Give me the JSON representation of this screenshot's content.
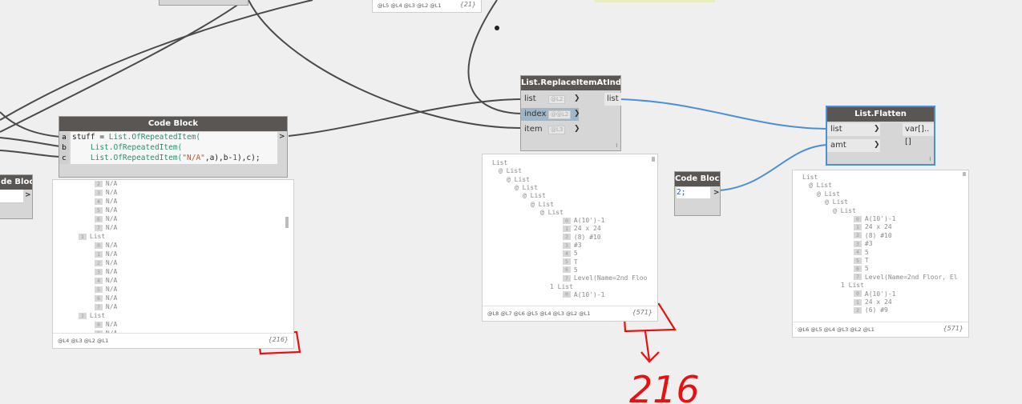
{
  "colors": {
    "canvas": "#efefef",
    "title_bar": "#5a5654",
    "node_body": "#d6d6d6",
    "wire": "#4a4a4a",
    "wire_active": "#4a90d9",
    "annotation": "#e81010"
  },
  "code_block_main": {
    "title": "Code Block",
    "ports": [
      "a",
      "b",
      "c"
    ],
    "line1_prefix": "stuff = ",
    "line1_fn": "List.OfRepeatedItem(",
    "line2_fn": "List.OfRepeatedItem(",
    "line3_fn": "List.OfRepeatedItem(",
    "line3_str": "\"N/A\"",
    "line3_rest": ",a),b-",
    "line3_num": "1",
    "line3_end": "),c);",
    "output_arrow": ">"
  },
  "code_block_left": {
    "title": "de Block",
    "output_arrow": ">"
  },
  "code_block_small": {
    "title": "Code Block",
    "code_value": "2;",
    "output_arrow": ">"
  },
  "replace_node": {
    "title": "List.ReplaceItemAtIndex",
    "inputs": [
      {
        "label": "list",
        "lacing": "@L2"
      },
      {
        "label": "index",
        "lacing": "@@L2"
      },
      {
        "label": "item",
        "lacing": "@L3"
      }
    ],
    "output": "list",
    "corner": "l"
  },
  "flatten_node": {
    "title": "List.Flatten",
    "inputs": [
      {
        "label": "list"
      },
      {
        "label": "amt"
      }
    ],
    "output": "var[]..[]",
    "corner": "l"
  },
  "preview_main": {
    "rows": [
      {
        "indent": 0,
        "idx": "2",
        "text": "N/A"
      },
      {
        "indent": 0,
        "idx": "3",
        "text": "N/A"
      },
      {
        "indent": 0,
        "idx": "4",
        "text": "N/A"
      },
      {
        "indent": 0,
        "idx": "5",
        "text": "N/A"
      },
      {
        "indent": 0,
        "idx": "6",
        "text": "N/A"
      },
      {
        "indent": 0,
        "idx": "7",
        "text": "N/A"
      },
      {
        "indent": -1,
        "idx": "1",
        "text": "List"
      },
      {
        "indent": 0,
        "idx": "0",
        "text": "N/A"
      },
      {
        "indent": 0,
        "idx": "1",
        "text": "N/A"
      },
      {
        "indent": 0,
        "idx": "2",
        "text": "N/A"
      },
      {
        "indent": 0,
        "idx": "3",
        "text": "N/A"
      },
      {
        "indent": 0,
        "idx": "4",
        "text": "N/A"
      },
      {
        "indent": 0,
        "idx": "5",
        "text": "N/A"
      },
      {
        "indent": 0,
        "idx": "6",
        "text": "N/A"
      },
      {
        "indent": 0,
        "idx": "7",
        "text": "N/A"
      },
      {
        "indent": -1,
        "idx": "2",
        "text": "List"
      },
      {
        "indent": 0,
        "idx": "0",
        "text": "N/A"
      },
      {
        "indent": 0,
        "idx": "1",
        "text": "N/A"
      }
    ],
    "levels": "@L4 @L3 @L2 @L1",
    "count": "{216}"
  },
  "preview_replace": {
    "rows": [
      "List",
      "@ List",
      "@ List",
      "@ List",
      "@ List",
      "@ List",
      "@ List",
      "A(10')-1",
      "24 x 24",
      "(8) #10",
      "#3",
      "5",
      "T",
      "5",
      "Level(Name=2nd Floo",
      "1 List",
      "A(10')-1"
    ],
    "idx": [
      "0",
      "1",
      "2",
      "3",
      "4",
      "5",
      "6",
      "7"
    ],
    "levels": "@L8 @L7 @L6 @L5 @L4 @L3 @L2 @L1",
    "count": "{571}"
  },
  "preview_flatten": {
    "rows": [
      "List",
      "@ List",
      "@ List",
      "@ List",
      "@ List",
      "A(10')-1",
      "24 x 24",
      "(8) #10",
      "#3",
      "5",
      "T",
      "5",
      "Level(Name=2nd Floor, El",
      "1 List",
      "A(10')-1",
      "24 x 24",
      "(6) #9"
    ],
    "levels": "@L6 @L5 @L4 @L3 @L2 @L1",
    "count": "{571}"
  },
  "preview_top": {
    "levels": "@L5 @L4 @L3 @L2 @L1",
    "count": "{21}"
  },
  "annotation": {
    "handwritten_number": "216"
  }
}
